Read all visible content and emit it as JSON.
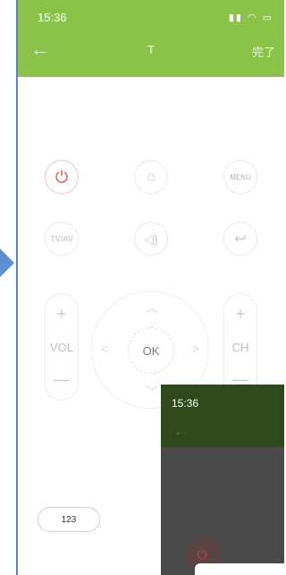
{
  "status_bar": {
    "time": "15:36",
    "icons": "signal wifi battery"
  },
  "header": {
    "back_icon": "←",
    "title": "T",
    "done_label": "完了"
  },
  "remote": {
    "power_icon": "⏻",
    "home_icon": "⌂",
    "menu_label": "MENU",
    "tvav_label": "TV/AV",
    "mute_icon": "🔇",
    "return_icon": "↩",
    "vol": {
      "plus": "+",
      "label": "VOL",
      "minus": "—"
    },
    "ch": {
      "plus": "+",
      "label": "CH",
      "minus": "—"
    },
    "dpad": {
      "up": "^",
      "down": "v",
      "left": "<",
      "right": ">",
      "ok_label": "OK"
    },
    "numpad_label": "123"
  },
  "inset": {
    "time": "15:36",
    "back_icon": "←",
    "power_icon": "⏻"
  },
  "colors": {
    "header_green": "#8bc34a",
    "annotation_arrow": "#4f86c6",
    "power_red": "#e0534a"
  }
}
